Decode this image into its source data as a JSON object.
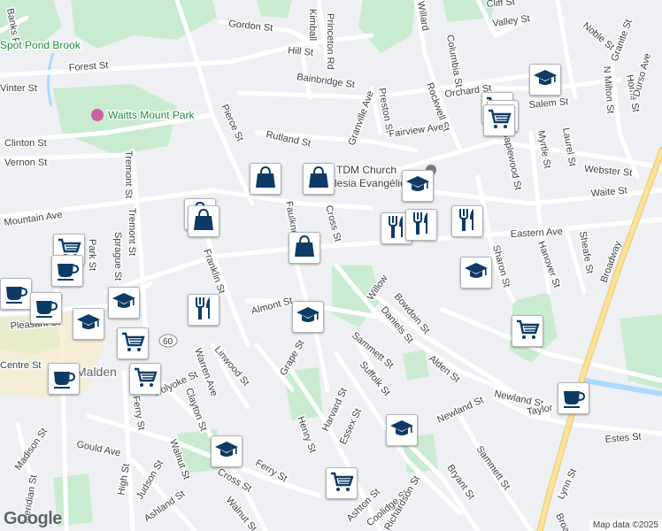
{
  "map": {
    "colors": {
      "background": "#eef0f3",
      "park": "#c9ecd0",
      "road": "#ffffff",
      "highway": "#fbe29c",
      "water": "#aadaff",
      "marker_icon": "#0d3b66"
    },
    "streets": [
      "Forest St",
      "Gordon St",
      "Hill St",
      "Kimball",
      "Princeton Rd",
      "Willard",
      "Columbia St",
      "Cliff St",
      "Valley St",
      "Noble St",
      "Granite St",
      "Orchard St",
      "Rockwell St",
      "Bainbridge St",
      "Preston St",
      "Granville Ave",
      "Fairview Ave",
      "Rutland St",
      "Pierce St",
      "Salem St",
      "Clinton St",
      "Vernon St",
      "Tremont St",
      "Tremont St",
      "Mountain Ave",
      "Sprague St",
      "Park St",
      "Franklin St",
      "Faulkner",
      "Cross St",
      "Eastern Ave",
      "Waite St",
      "Webster St",
      "Laurel St",
      "Myrtle St",
      "Maplewood St",
      "Sharon St",
      "Hanover St",
      "Sheafe St",
      "Broadway",
      "Home St",
      "Durso Ave",
      "N Milton St",
      "Pleasant St",
      "Centre St",
      "Holyoke St",
      "Warren Ave",
      "Linwood St",
      "Almont St",
      "Bowdoin St",
      "Daniels St",
      "Willow",
      "Grape St",
      "Sammett St",
      "Suffolk St",
      "Alden St",
      "Newland St",
      "Taylor",
      "Estes St",
      "Clayton St",
      "Gould Ave",
      "Madison St",
      "Meridian St",
      "High St",
      "Judson St",
      "Ashland St",
      "Walnut St",
      "Walnut St",
      "Ferry St",
      "Ferry St",
      "Cross St",
      "Henry St",
      "Harvard St",
      "Essex St",
      "Newland St",
      "Bryant St",
      "Sammett St",
      "Lynn St",
      "Ashton St",
      "Coolidge St",
      "Richardson St",
      "Vinter St",
      "Banks Pl",
      "Broadway"
    ],
    "parks": [
      "Waitts Mount Park",
      "Spot Pond Brook"
    ],
    "pois": [
      "TDM Church",
      "Iglesia Evangélica"
    ],
    "city_fragment": "Malden",
    "route_shield": "60",
    "markers": [
      {
        "type": "education",
        "icon": "graduation-cap-icon"
      },
      {
        "type": "shopping-cart",
        "icon": "cart-icon"
      },
      {
        "type": "shopping-cart",
        "icon": "cart-icon"
      },
      {
        "type": "shopping-cart",
        "icon": "cart-icon"
      },
      {
        "type": "shopping-bag",
        "icon": "shopping-bag-icon"
      },
      {
        "type": "shopping-bag",
        "icon": "shopping-bag-icon"
      },
      {
        "type": "education",
        "icon": "graduation-cap-icon"
      },
      {
        "type": "restaurant",
        "icon": "fork-knife-icon"
      },
      {
        "type": "restaurant",
        "icon": "fork-knife-icon"
      },
      {
        "type": "restaurant",
        "icon": "fork-knife-icon"
      },
      {
        "type": "shopping-bag",
        "icon": "shopping-bag-icon"
      },
      {
        "type": "shopping-bag",
        "icon": "shopping-bag-icon"
      },
      {
        "type": "shopping-bag",
        "icon": "shopping-bag-icon"
      },
      {
        "type": "education",
        "icon": "graduation-cap-icon"
      },
      {
        "type": "shopping-cart",
        "icon": "cart-icon"
      },
      {
        "type": "cafe",
        "icon": "coffee-cup-icon"
      },
      {
        "type": "cafe",
        "icon": "coffee-cup-icon"
      },
      {
        "type": "cafe",
        "icon": "coffee-cup-icon"
      },
      {
        "type": "education",
        "icon": "graduation-cap-icon"
      },
      {
        "type": "education",
        "icon": "graduation-cap-icon"
      },
      {
        "type": "restaurant",
        "icon": "fork-knife-icon"
      },
      {
        "type": "shopping-cart",
        "icon": "cart-icon"
      },
      {
        "type": "education",
        "icon": "graduation-cap-icon"
      },
      {
        "type": "shopping-cart",
        "icon": "cart-icon"
      },
      {
        "type": "cafe",
        "icon": "coffee-cup-icon"
      },
      {
        "type": "shopping-cart",
        "icon": "cart-icon"
      },
      {
        "type": "cafe",
        "icon": "coffee-cup-icon"
      },
      {
        "type": "education",
        "icon": "graduation-cap-icon"
      },
      {
        "type": "education",
        "icon": "graduation-cap-icon"
      },
      {
        "type": "shopping-cart",
        "icon": "cart-icon"
      }
    ]
  },
  "footer": {
    "logo": "Google",
    "attribution": "Map data ©2025"
  }
}
